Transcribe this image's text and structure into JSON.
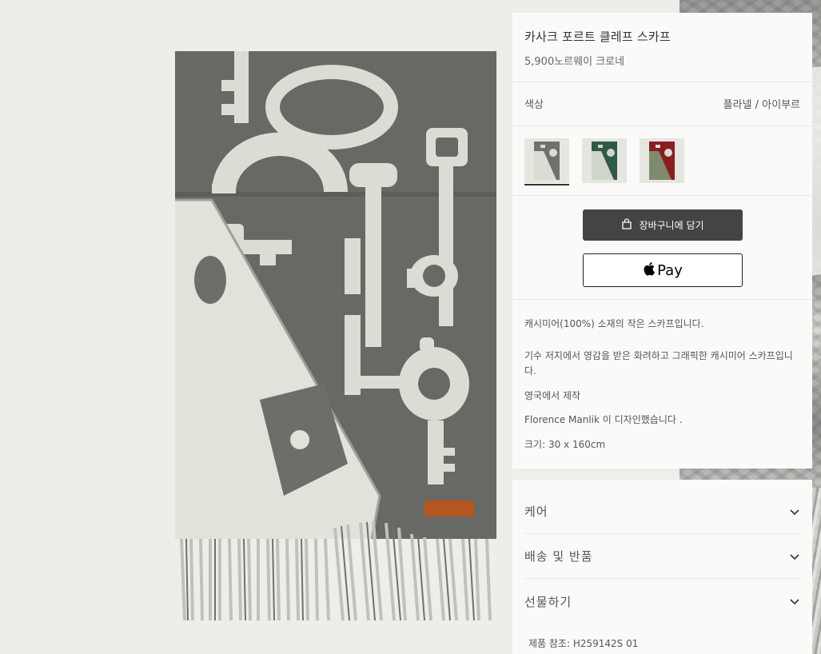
{
  "product": {
    "title": "카사크 포르트 클레프 스카프",
    "price": "5,900노르웨이 크로네",
    "color_label": "색상",
    "color_value": "플라넬 / 아이부르",
    "swatches": [
      {
        "name": "gray",
        "color": "#6e716c"
      },
      {
        "name": "green",
        "color": "#2f5a45"
      },
      {
        "name": "red",
        "color": "#8b1d1f"
      }
    ]
  },
  "actions": {
    "add_to_cart": "장바구니에 담기",
    "apple_pay": "Pay"
  },
  "description": {
    "line1": "캐시미어(100%) 소재의 작은 스카프입니다.",
    "line2": "기수 저지에서 영감을 받은 화려하고 그래픽한 캐시미어 스카프입니다.",
    "line3": "영국에서 제작",
    "line4": " Florence Manlik 이 디자인했습니다 .",
    "line5": "크기: 30 x 160cm"
  },
  "accordion": {
    "care": "케어",
    "shipping": "배송 및 반품",
    "gift": "선물하기"
  },
  "reference": "제품 참조: H259142S 01",
  "colors": {
    "scarf_dark": "#666865",
    "scarf_light": "#d9ddd3",
    "cart_button": "#444444",
    "panel_bg": "#fbfaf9",
    "page_bg": "#efedea"
  }
}
